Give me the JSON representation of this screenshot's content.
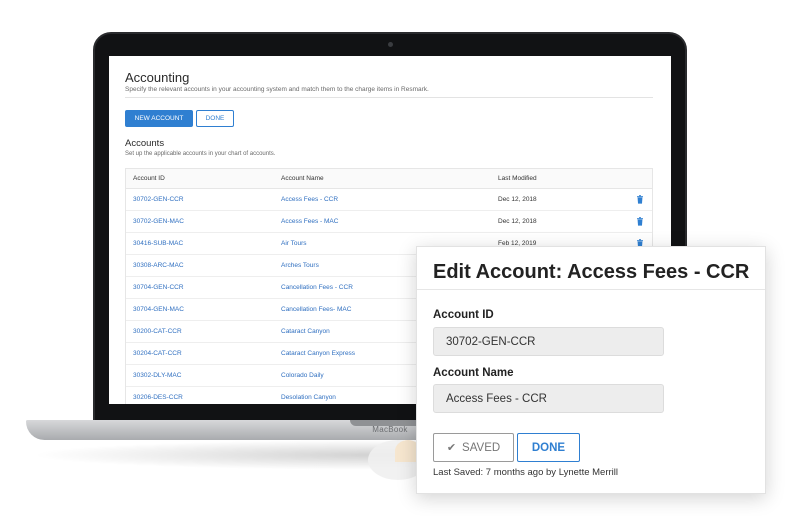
{
  "screen": {
    "title": "Accounting",
    "subtitle": "Specify the relevant accounts in your accounting system and match them to the charge items in Resmark.",
    "new_account_label": "NEW ACCOUNT",
    "done_label": "DONE",
    "section_title": "Accounts",
    "section_subtitle": "Set up the applicable accounts in your chart of accounts.",
    "columns": [
      "Account ID",
      "Account Name",
      "Last Modified"
    ],
    "rows": [
      {
        "id": "30702-GEN-CCR",
        "name": "Access Fees - CCR",
        "modified": "Dec 12, 2018"
      },
      {
        "id": "30702-GEN-MAC",
        "name": "Access Fees - MAC",
        "modified": "Dec 12, 2018"
      },
      {
        "id": "30416-SUB-MAC",
        "name": "Air Tours",
        "modified": "Feb 12, 2019"
      },
      {
        "id": "30308-ARC-MAC",
        "name": "Arches Tours",
        "modified": ""
      },
      {
        "id": "30704-GEN-CCR",
        "name": "Cancellation Fees - CCR",
        "modified": ""
      },
      {
        "id": "30704-GEN-MAC",
        "name": "Cancellation Fees- MAC",
        "modified": ""
      },
      {
        "id": "30200-CAT-CCR",
        "name": "Cataract Canyon",
        "modified": ""
      },
      {
        "id": "30204-CAT-CCR",
        "name": "Cataract Canyon Express",
        "modified": ""
      },
      {
        "id": "30302-DLY-MAC",
        "name": "Colorado Daily",
        "modified": ""
      },
      {
        "id": "30206-DES-CCR",
        "name": "Desolation Canyon",
        "modified": ""
      }
    ]
  },
  "laptop_label": "MacBook",
  "popup": {
    "title": "Edit Account: Access Fees - CCR",
    "account_id_label": "Account ID",
    "account_id_value": "30702-GEN-CCR",
    "account_name_label": "Account Name",
    "account_name_value": "Access Fees - CCR",
    "saved_label": "SAVED",
    "done_label": "DONE",
    "last_saved": "Last Saved: 7 months ago by Lynette Merrill"
  },
  "colors": {
    "accent": "#2f7fd1",
    "link": "#2f6fc0",
    "bezel": "#111214"
  }
}
